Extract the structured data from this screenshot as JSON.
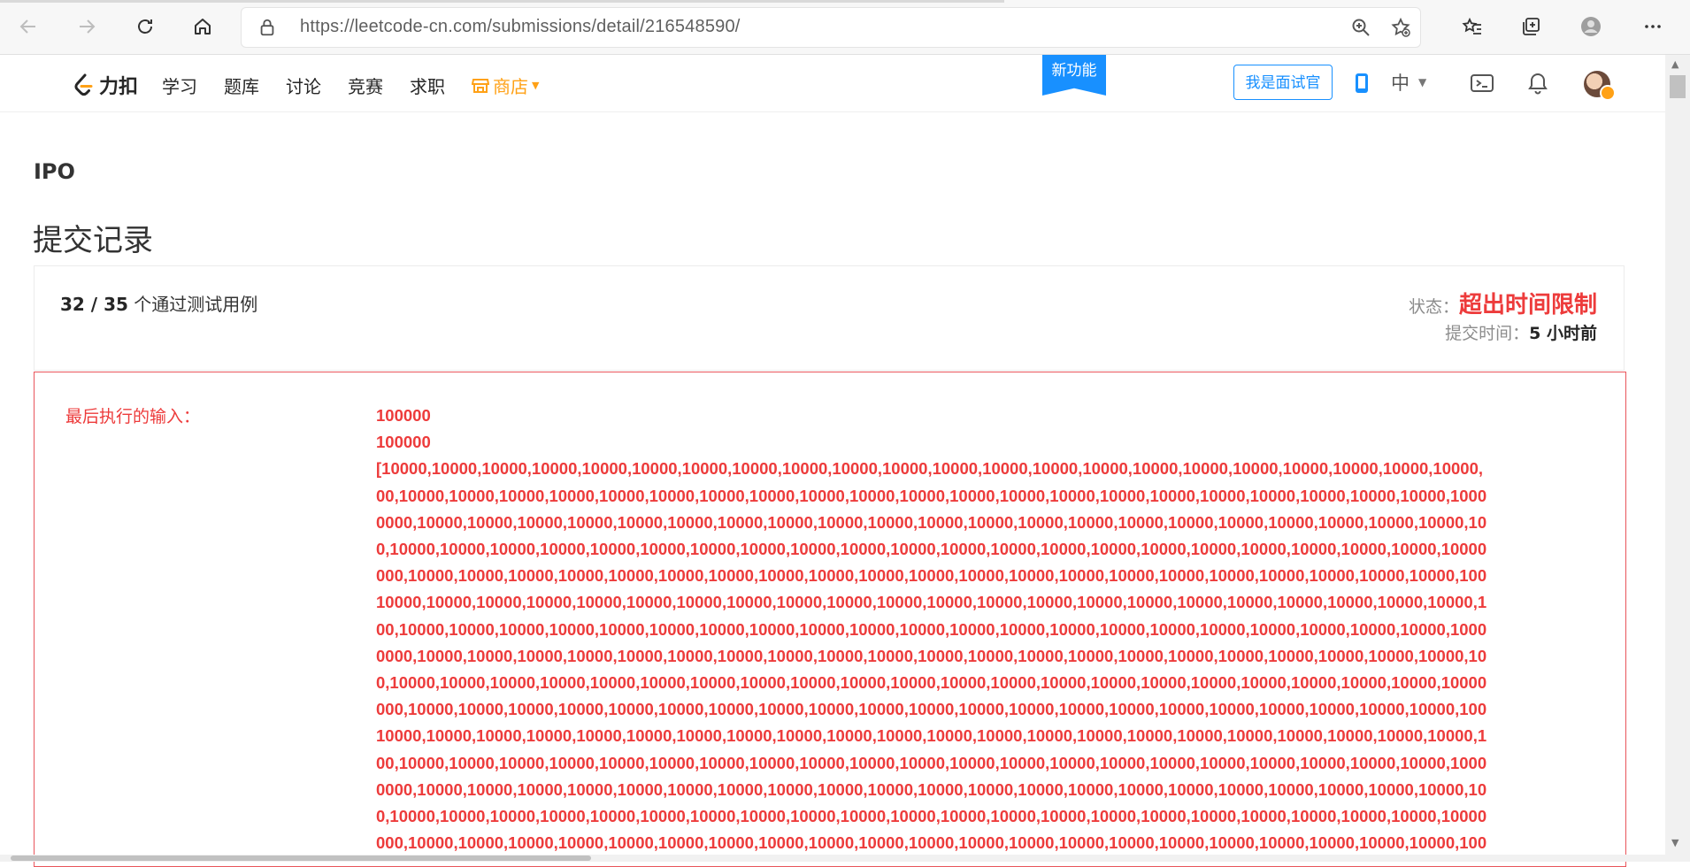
{
  "browser": {
    "url": "https://leetcode-cn.com/submissions/detail/216548590/"
  },
  "header": {
    "logo_text": "力扣",
    "nav": [
      "学习",
      "题库",
      "讨论",
      "竞赛",
      "求职"
    ],
    "shop_label": "商店",
    "new_feature": "新功能",
    "interviewer_button": "我是面试官",
    "language": "中"
  },
  "page": {
    "problem_title": "IPO",
    "heading": "提交记录"
  },
  "result": {
    "passed_count": "32 / 35",
    "passed_suffix": " 个通过测试用例",
    "status_label": "状态：",
    "status_value": "超出时间限制",
    "time_label": "提交时间：",
    "time_value": "5 小时前"
  },
  "last_input": {
    "label": "最后执行的输入：",
    "lines": [
      "100000",
      "100000",
      "[10000,10000,10000,10000,10000,10000,10000,10000,10000,10000,10000,10000,10000,10000,10000,10000,10000,10000,10000,10000,10000,10000,",
      "00,10000,10000,10000,10000,10000,10000,10000,10000,10000,10000,10000,10000,10000,10000,10000,10000,10000,10000,10000,10000,10000,1000",
      "0000,10000,10000,10000,10000,10000,10000,10000,10000,10000,10000,10000,10000,10000,10000,10000,10000,10000,10000,10000,10000,10000,10",
      "0,10000,10000,10000,10000,10000,10000,10000,10000,10000,10000,10000,10000,10000,10000,10000,10000,10000,10000,10000,10000,10000,10000",
      "000,10000,10000,10000,10000,10000,10000,10000,10000,10000,10000,10000,10000,10000,10000,10000,10000,10000,10000,10000,10000,10000,100",
      "10000,10000,10000,10000,10000,10000,10000,10000,10000,10000,10000,10000,10000,10000,10000,10000,10000,10000,10000,10000,10000,10000,1",
      "00,10000,10000,10000,10000,10000,10000,10000,10000,10000,10000,10000,10000,10000,10000,10000,10000,10000,10000,10000,10000,10000,1000",
      "0000,10000,10000,10000,10000,10000,10000,10000,10000,10000,10000,10000,10000,10000,10000,10000,10000,10000,10000,10000,10000,10000,10",
      "0,10000,10000,10000,10000,10000,10000,10000,10000,10000,10000,10000,10000,10000,10000,10000,10000,10000,10000,10000,10000,10000,10000",
      "000,10000,10000,10000,10000,10000,10000,10000,10000,10000,10000,10000,10000,10000,10000,10000,10000,10000,10000,10000,10000,10000,100",
      "10000,10000,10000,10000,10000,10000,10000,10000,10000,10000,10000,10000,10000,10000,10000,10000,10000,10000,10000,10000,10000,10000,1",
      "00,10000,10000,10000,10000,10000,10000,10000,10000,10000,10000,10000,10000,10000,10000,10000,10000,10000,10000,10000,10000,10000,1000",
      "0000,10000,10000,10000,10000,10000,10000,10000,10000,10000,10000,10000,10000,10000,10000,10000,10000,10000,10000,10000,10000,10000,10",
      "0,10000,10000,10000,10000,10000,10000,10000,10000,10000,10000,10000,10000,10000,10000,10000,10000,10000,10000,10000,10000,10000,10000",
      "000,10000,10000,10000,10000,10000,10000,10000,10000,10000,10000,10000,10000,10000,10000,10000,10000,10000,10000,10000,10000,10000,100"
    ]
  },
  "colors": {
    "accent_blue": "#1890ff",
    "shop_orange": "#ffa116",
    "error_red": "#ed3b3b"
  },
  "icons": [
    "back-icon",
    "forward-icon",
    "reload-icon",
    "home-icon",
    "lock-icon",
    "zoom-icon",
    "add-favorite-icon",
    "favorites-icon",
    "collections-icon",
    "profile-icon",
    "more-icon",
    "mobile-icon",
    "terminal-icon",
    "bell-icon"
  ]
}
